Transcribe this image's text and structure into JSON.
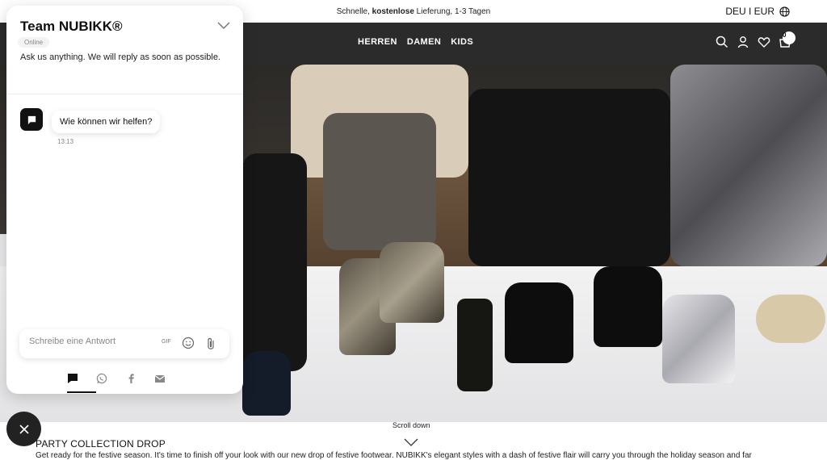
{
  "announcement": {
    "pre": "Schnelle, ",
    "bold": "kostenlose",
    "post": " Lieferung, 1-3 Tagen",
    "locale": "DEU I EUR"
  },
  "nav": {
    "links": [
      "HERREN",
      "DAMEN",
      "KIDS"
    ],
    "cart_count": "0",
    "icons": [
      "search-icon",
      "user-icon",
      "heart-icon",
      "cart-icon",
      "globe-icon"
    ]
  },
  "hero": {
    "scroll_label": "Scroll down"
  },
  "section": {
    "title": "PARTY COLLECTION DROP",
    "text": "Get ready for the festive season. It's time to finish off your look with our new drop of festive footwear. NUBIKK's elegant styles with a dash of festive flair will carry you through the holiday season and far"
  },
  "chat": {
    "title": "Team NUBIKK®",
    "status": "Online",
    "subtitle": "Ask us anything. We will reply as soon as possible.",
    "message": "Wie können wir helfen?",
    "message_time": "13:13",
    "input_placeholder": "Schreibe eine Antwort",
    "gif_label": "GIF",
    "channels": [
      "chat-icon",
      "whatsapp-icon",
      "facebook-icon",
      "email-icon"
    ]
  }
}
